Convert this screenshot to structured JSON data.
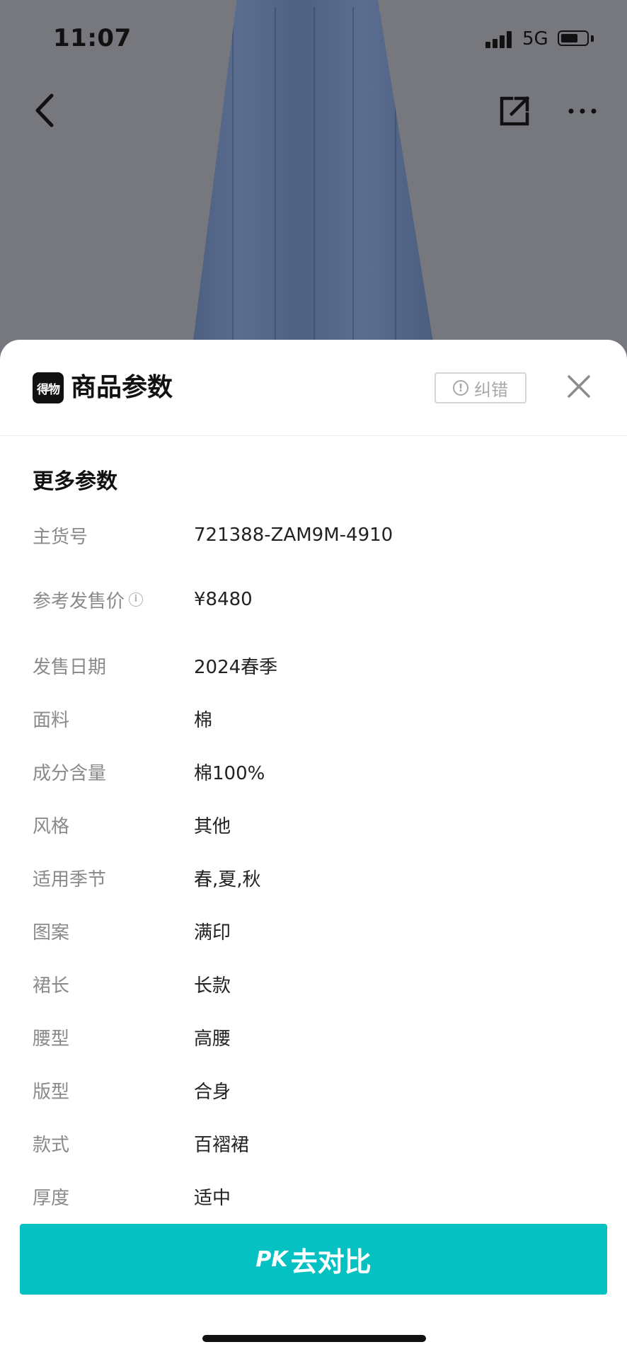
{
  "status_bar": {
    "time": "11:07",
    "network": "5G",
    "battery_level": 0.7
  },
  "nav": {
    "back_icon": "chevron-left-icon",
    "share_icon": "share-external-icon",
    "more_icon": "more-dots-icon"
  },
  "sheet": {
    "brand_logo_text": "得物",
    "title": "商品参数",
    "report_label": "纠错",
    "close_icon": "close-icon"
  },
  "section_title": "更多参数",
  "params": [
    {
      "label": "主货号",
      "value": "721388-ZAM9M-4910"
    },
    {
      "label": "参考发售价",
      "value": "¥8480",
      "has_info": true
    },
    {
      "label": "发售日期",
      "value": "2024春季"
    },
    {
      "label": "面料",
      "value": "棉"
    },
    {
      "label": "成分含量",
      "value": "棉100%"
    },
    {
      "label": "风格",
      "value": "其他"
    },
    {
      "label": "适用季节",
      "value": "春,夏,秋"
    },
    {
      "label": "图案",
      "value": "满印"
    },
    {
      "label": "裙长",
      "value": "长款"
    },
    {
      "label": "腰型",
      "value": "高腰"
    },
    {
      "label": "版型",
      "value": "合身"
    },
    {
      "label": "款式",
      "value": "百褶裙"
    },
    {
      "label": "厚度",
      "value": "适中"
    }
  ],
  "pk_button": {
    "mark": "PK",
    "label": "去对比"
  },
  "colors": {
    "accent": "#05c1c1",
    "overlay": "#7a7b80",
    "label_gray": "#8a8a8a"
  }
}
